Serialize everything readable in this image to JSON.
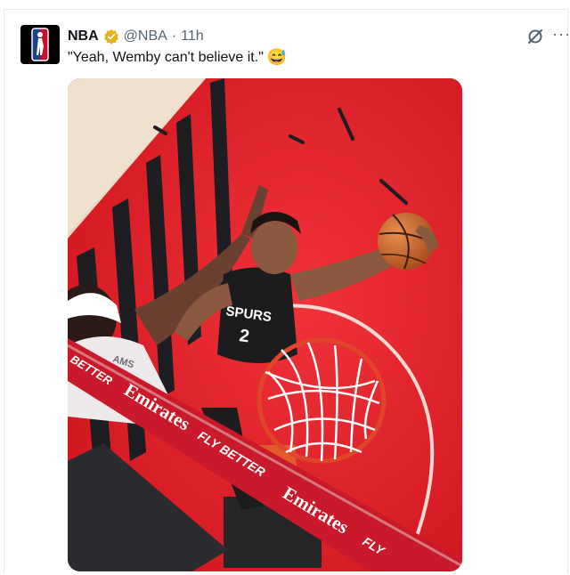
{
  "tweet": {
    "account_name": "NBA",
    "handle": "@NBA",
    "separator": "·",
    "time": "11h",
    "text": "\"Yeah, Wemby can't believe it.\"",
    "emoji": "😅",
    "more_label": "···"
  },
  "media": {
    "jersey_team": "SPURS",
    "jersey_number": "2",
    "opponent_name_fragment": "AMS",
    "sponsor_text": "Emirates",
    "sponsor_slogan": "FLY BETTER",
    "sponsor_slogan_fragment": "BETTER",
    "sponsor_text_fragment": "FLY"
  },
  "colors": {
    "court_red": "#e8202a",
    "brand_blue": "#1d9bf0",
    "verified_gold": "#e8b21e"
  }
}
